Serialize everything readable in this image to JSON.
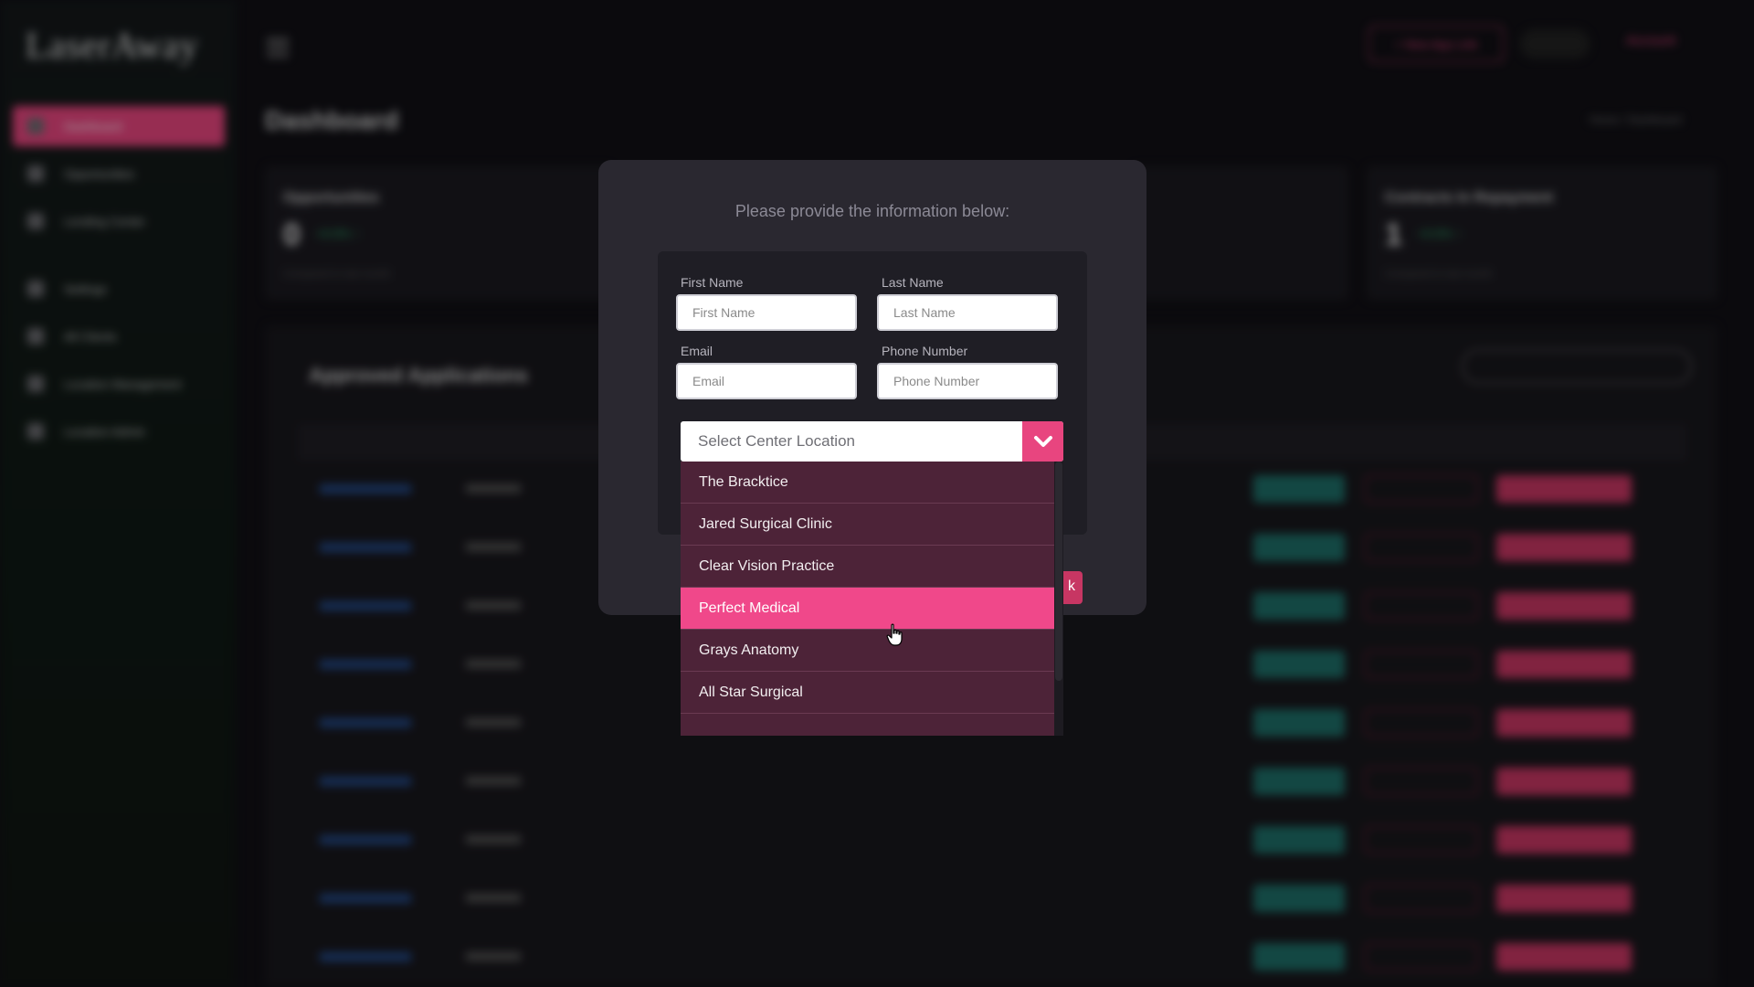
{
  "app": {
    "logo": "LaserAway",
    "sidebar": {
      "items": [
        {
          "label": "Dashboard",
          "active": true
        },
        {
          "label": "Opportunities"
        },
        {
          "label": "Lending Center"
        },
        {
          "label": "Settings"
        },
        {
          "label": "All Clients"
        },
        {
          "label": "Location Management"
        },
        {
          "label": "Location Admin"
        }
      ]
    },
    "topbar": {
      "new_app_label": "+ New App Link",
      "user_name": "Account"
    },
    "page_title": "Dashboard",
    "breadcrumb": "Home / Dashboard",
    "stats": [
      {
        "label": "Opportunities",
        "value": "0",
        "delta": "+0.0% ↑",
        "sub": "Compared to last month"
      },
      {
        "label": "Contracts In Repayment",
        "value": "1",
        "delta": "+0.0% ↑",
        "sub": "Compared to last month"
      }
    ],
    "table": {
      "title": "Approved Applications",
      "search_placeholder": "Search"
    }
  },
  "modal": {
    "prompt": "Please provide the information below:",
    "first_name": {
      "label": "First Name",
      "placeholder": "First Name"
    },
    "last_name": {
      "label": "Last Name",
      "placeholder": "Last Name"
    },
    "email": {
      "label": "Email",
      "placeholder": "Email"
    },
    "phone": {
      "label": "Phone Number",
      "placeholder": "Phone Number"
    },
    "center_select": {
      "placeholder": "Select Center Location",
      "options": [
        "The Bracktice",
        "Jared Surgical Clinic",
        "Clear Vision Practice",
        "Perfect Medical",
        "Grays Anatomy",
        "All Star Surgical"
      ],
      "highlighted": "Perfect Medical"
    }
  },
  "colors": {
    "accent": "#e8457f",
    "highlight": "#f0488a",
    "dropdown_bg": "#4d2338",
    "modal_bg": "#2a2830"
  }
}
